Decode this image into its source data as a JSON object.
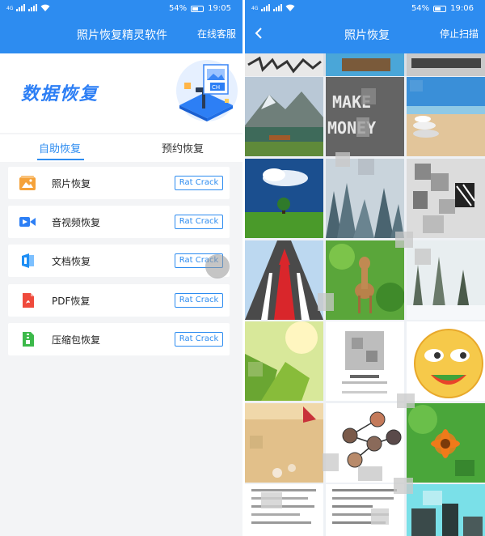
{
  "status_left": {
    "signal_tag": "4G",
    "battery": "54%",
    "time": "19:05"
  },
  "status_right": {
    "battery": "54%",
    "time": "19:06"
  },
  "left_screen": {
    "title": "照片恢复精灵软件",
    "header_action": "在线客服",
    "banner_title": "数据恢复",
    "tabs": [
      {
        "label": "自助恢复",
        "active": true
      },
      {
        "label": "预约恢复",
        "active": false
      }
    ],
    "items": [
      {
        "label": "照片恢复",
        "icon": "photo-icon",
        "button": "Rat Crack"
      },
      {
        "label": "音视频恢复",
        "icon": "video-icon",
        "button": "Rat Crack"
      },
      {
        "label": "文档恢复",
        "icon": "document-icon",
        "button": "Rat Crack"
      },
      {
        "label": "PDF恢复",
        "icon": "pdf-icon",
        "button": "Rat Crack"
      },
      {
        "label": "压缩包恢复",
        "icon": "zip-icon",
        "button": "Rat Crack"
      }
    ]
  },
  "right_screen": {
    "title": "照片恢复",
    "header_action": "停止扫描",
    "photos": [
      "mountain-lake",
      "make-money-chalkboard",
      "beach-stones",
      "tree-field",
      "foggy-forest",
      "pixelated-image",
      "road-arrows",
      "deer",
      "snowy-trees",
      "sunlit-leaves",
      "document-card",
      "emoji-face",
      "sand-shells",
      "network-avatars",
      "orange-flower",
      "text-document",
      "text-document-2",
      "cyan-sky"
    ]
  },
  "colors": {
    "header_blue": "#2d8cf0",
    "banner_title_blue": "#2d7ff5",
    "background": "#f3f4f6"
  }
}
